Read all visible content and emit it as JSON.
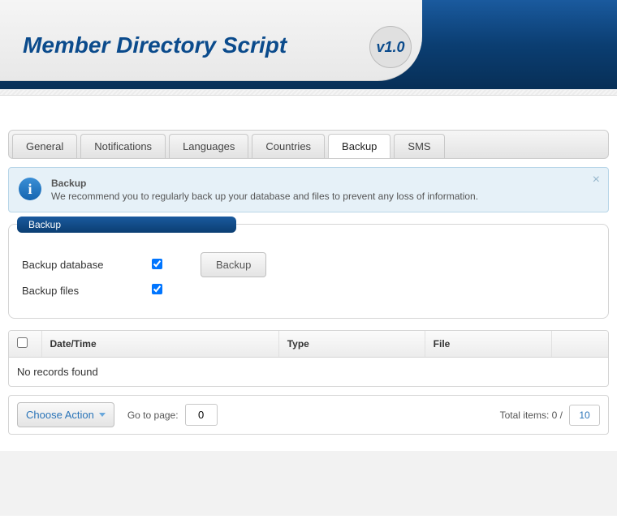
{
  "header": {
    "title": "Member Directory Script",
    "version": "v1.0"
  },
  "tabs": [
    {
      "label": "General",
      "active": false
    },
    {
      "label": "Notifications",
      "active": false
    },
    {
      "label": "Languages",
      "active": false
    },
    {
      "label": "Countries",
      "active": false
    },
    {
      "label": "Backup",
      "active": true
    },
    {
      "label": "SMS",
      "active": false
    }
  ],
  "notice": {
    "title": "Backup",
    "body": "We recommend you to regularly back up your database and files to prevent any loss of information.",
    "icon": "i"
  },
  "panel": {
    "legend": "Backup",
    "backup_db_label": "Backup database",
    "backup_files_label": "Backup files",
    "backup_button": "Backup"
  },
  "table": {
    "columns": [
      "Date/Time",
      "Type",
      "File"
    ],
    "empty_message": "No records found"
  },
  "footer": {
    "choose_action": "Choose Action",
    "goto_label": "Go to page:",
    "goto_value": "0",
    "total_label": "Total items: 0 /",
    "page_size": "10"
  }
}
